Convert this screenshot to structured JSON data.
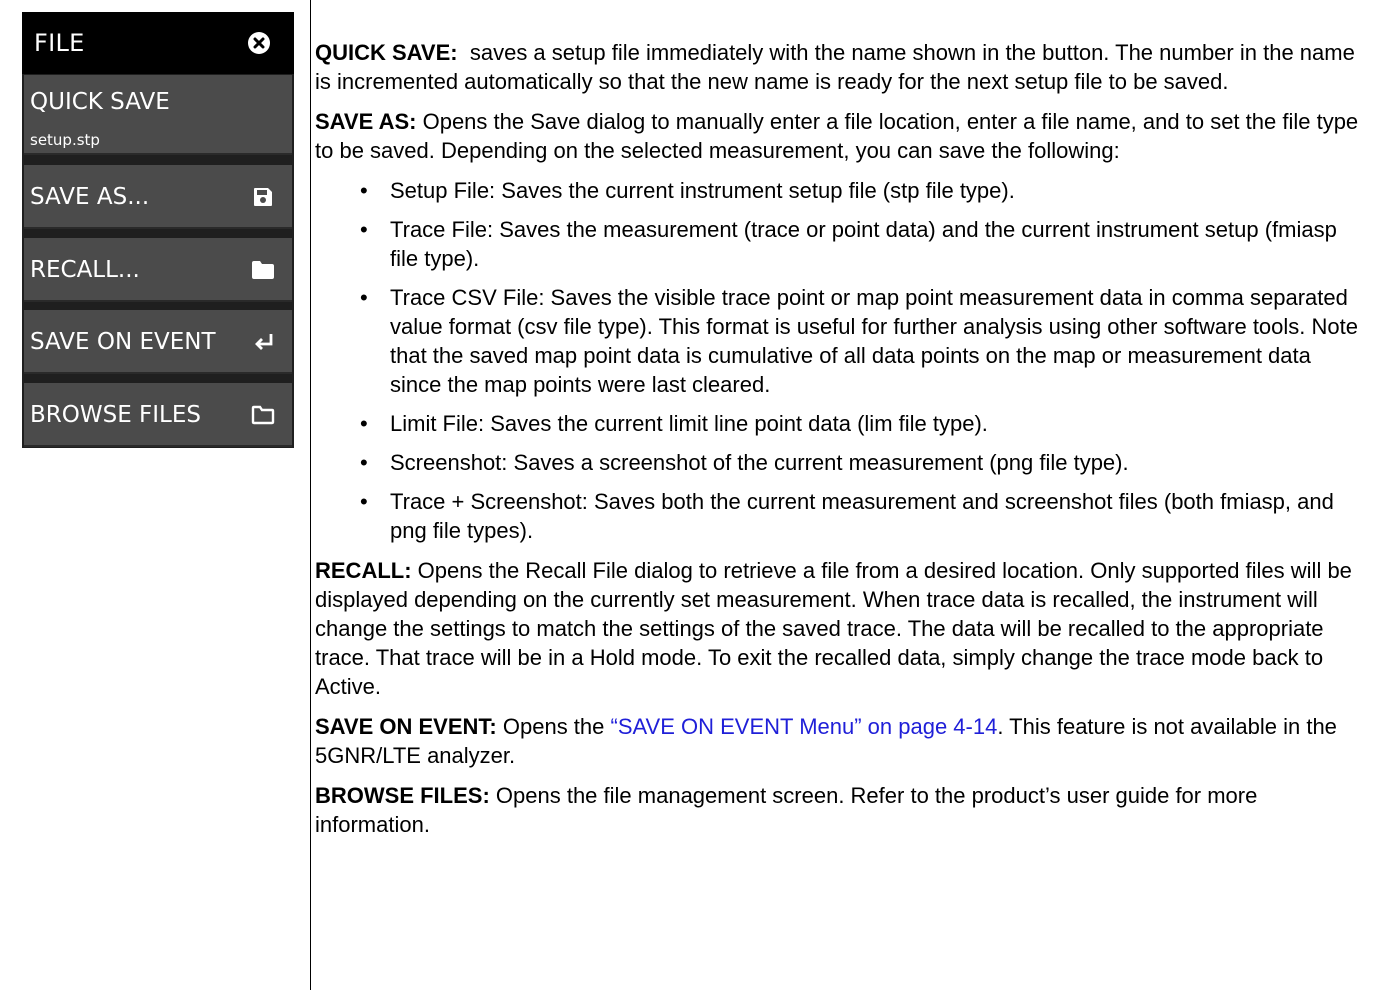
{
  "menu": {
    "title": "FILE",
    "close_icon": "close-circle-icon",
    "buttons": [
      {
        "label": "QUICK SAVE",
        "sublabel": "setup.stp"
      },
      {
        "label": "SAVE AS...",
        "icon": "floppy-disk-icon"
      },
      {
        "label": "RECALL...",
        "icon": "folder-icon"
      },
      {
        "label": "SAVE ON EVENT",
        "icon": "enter-arrow-icon"
      },
      {
        "label": "BROWSE FILES",
        "icon": "folder-outline-icon"
      }
    ],
    "colors": {
      "header_bg": "#000000",
      "button_bg": "#4b4b4b",
      "text": "#ffffff"
    }
  },
  "descriptions": {
    "quick_save": {
      "term": "QUICK SAVE:",
      "text": "saves a setup file immediately with the name shown in the button. The number in the name is incremented automatically so that the new name is ready for the next setup file to be saved."
    },
    "save_as": {
      "term": "SAVE AS:",
      "text": "Opens the Save dialog to manually enter a file location, enter a file name, and to set the file type to be saved. Depending on the selected measurement, you can save the following:",
      "bullets": [
        "Setup File: Saves the current instrument setup file (stp file type).",
        "Trace File: Saves the measurement (trace or point data) and the current instrument setup (fmiasp file type).",
        "Trace CSV File: Saves the visible trace point or map point measurement data in comma separated value format (csv file type). This format is useful for further analysis using other software tools. Note that the saved map point data is cumulative of all data points on the map or measurement data since the map points were last cleared.",
        "Limit File: Saves the current limit line point data (lim file type).",
        "Screenshot: Saves a screenshot of the current measurement (png file type).",
        "Trace + Screenshot: Saves both the current measurement and screenshot files (both fmiasp, and png file types)."
      ]
    },
    "recall": {
      "term": "RECALL:",
      "text": "Opens the Recall File dialog to retrieve a file from a desired location. Only supported files will be displayed depending on the currently set measurement. When trace data is recalled, the instrument will change the settings to match the settings of the saved trace. The data will be recalled to the appropriate trace. That trace will be in a Hold mode. To exit the recalled data, simply change the trace mode back to Active."
    },
    "save_on_event": {
      "term": "SAVE ON EVENT:",
      "text_before": "Opens the",
      "link": "“SAVE ON EVENT Menu” on page 4-14",
      "text_after": ". This feature is not available in the 5GNR/LTE analyzer.",
      "link_color": "#1f1fd8"
    },
    "browse_files": {
      "term": "BROWSE FILES:",
      "text": "Opens the file management screen. Refer to the product’s user guide for more information."
    }
  }
}
